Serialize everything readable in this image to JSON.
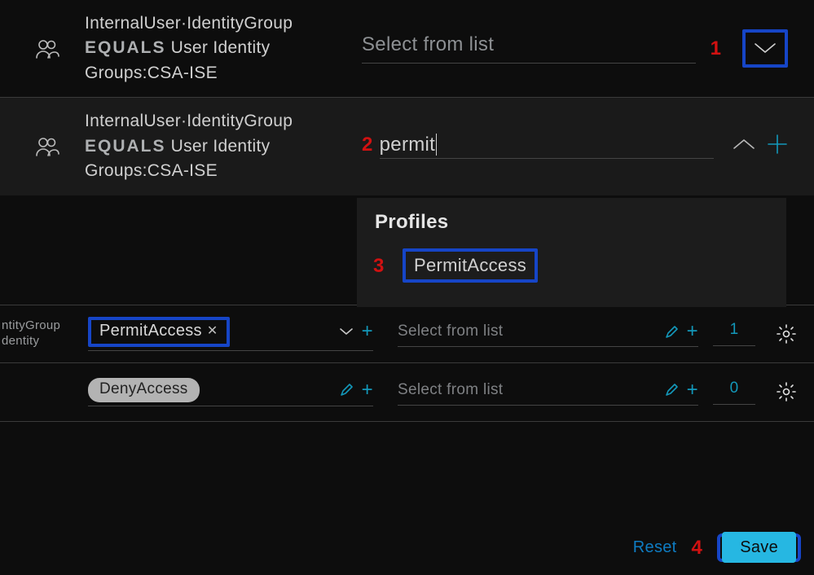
{
  "condition1": {
    "line1": "InternalUser·IdentityGroup",
    "operator": "EQUALS",
    "line2_after": "User Identity",
    "line3": "Groups:CSA-ISE",
    "select_placeholder": "Select from list"
  },
  "condition2": {
    "line1": "InternalUser·IdentityGroup",
    "operator": "EQUALS",
    "line2_after": "User Identity",
    "line3": "Groups:CSA-ISE",
    "search_value": "permit"
  },
  "dropdown": {
    "title": "Profiles",
    "options": [
      "PermitAccess"
    ]
  },
  "grid_row_1": {
    "left_frag_line1": "ntityGroup",
    "left_frag_line2": "dentity",
    "profile_chip": "PermitAccess",
    "secgrp_placeholder": "Select from list",
    "count": "1"
  },
  "grid_row_2": {
    "profile_chip": "DenyAccess",
    "secgrp_placeholder": "Select from list",
    "count": "0"
  },
  "footer": {
    "reset": "Reset",
    "save": "Save"
  },
  "annotations": {
    "n1": "1",
    "n2": "2",
    "n3": "3",
    "n4": "4"
  }
}
